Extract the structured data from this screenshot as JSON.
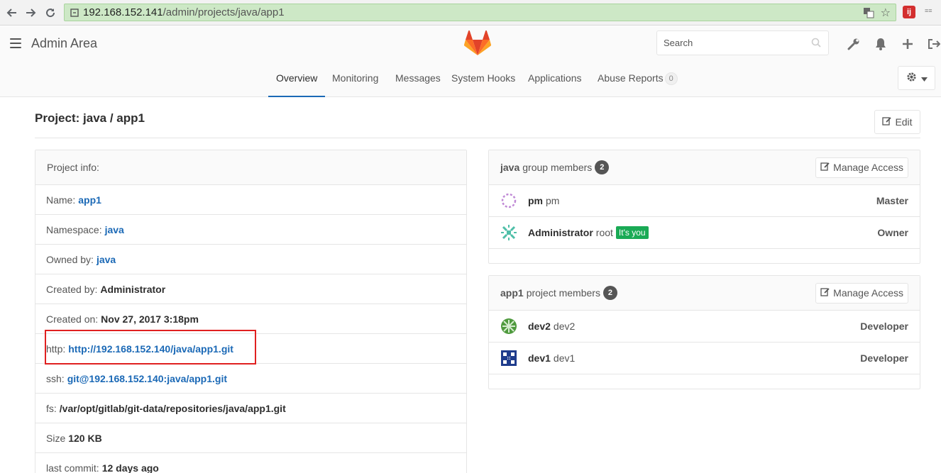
{
  "browser": {
    "url_host": "192.168.152.141",
    "url_path": "/admin/projects/java/app1",
    "ext_label": "ij",
    "ext2_label": "≡≡"
  },
  "header": {
    "area_title": "Admin Area",
    "search_placeholder": "Search",
    "tabs": [
      {
        "label": "Overview"
      },
      {
        "label": "Monitoring"
      },
      {
        "label": "Messages"
      },
      {
        "label": "System Hooks"
      },
      {
        "label": "Applications"
      },
      {
        "label": "Abuse Reports",
        "count": "0"
      }
    ]
  },
  "page": {
    "title": "Project: java / app1",
    "edit_label": "Edit"
  },
  "project_info": {
    "heading": "Project info:",
    "rows": [
      {
        "label": "Name:",
        "value": "app1"
      },
      {
        "label": "Namespace:",
        "value": "java"
      },
      {
        "label": "Owned by:",
        "value": "java"
      },
      {
        "label": "Created by:",
        "value": "Administrator"
      },
      {
        "label": "Created on:",
        "value": "Nov 27, 2017 3:18pm"
      },
      {
        "label": "http:",
        "value": "http://192.168.152.140/java/app1.git"
      },
      {
        "label": "ssh:",
        "value": "git@192.168.152.140:java/app1.git"
      },
      {
        "label": "fs:",
        "value": "/var/opt/gitlab/git-data/repositories/java/app1.git"
      },
      {
        "label": "Size",
        "value": "120 KB"
      },
      {
        "label": "last commit:",
        "value": "12 days ago"
      }
    ]
  },
  "group_members": {
    "group_name": "java",
    "heading_suffix": "group members",
    "count": "2",
    "manage_label": "Manage Access",
    "members": [
      {
        "name": "pm",
        "username": "pm",
        "role": "Master"
      },
      {
        "name": "Administrator",
        "username": "root",
        "badge": "It's you",
        "role": "Owner"
      }
    ]
  },
  "project_members": {
    "project_name": "app1",
    "heading_suffix": "project members",
    "count": "2",
    "manage_label": "Manage Access",
    "members": [
      {
        "name": "dev2",
        "username": "dev2",
        "role": "Developer"
      },
      {
        "name": "dev1",
        "username": "dev1",
        "role": "Developer"
      }
    ]
  },
  "colors": {
    "link": "#1b69b6",
    "active_tab": "#1b69b6",
    "you_badge": "#1aaa55",
    "highlight_box": "#e02020"
  }
}
